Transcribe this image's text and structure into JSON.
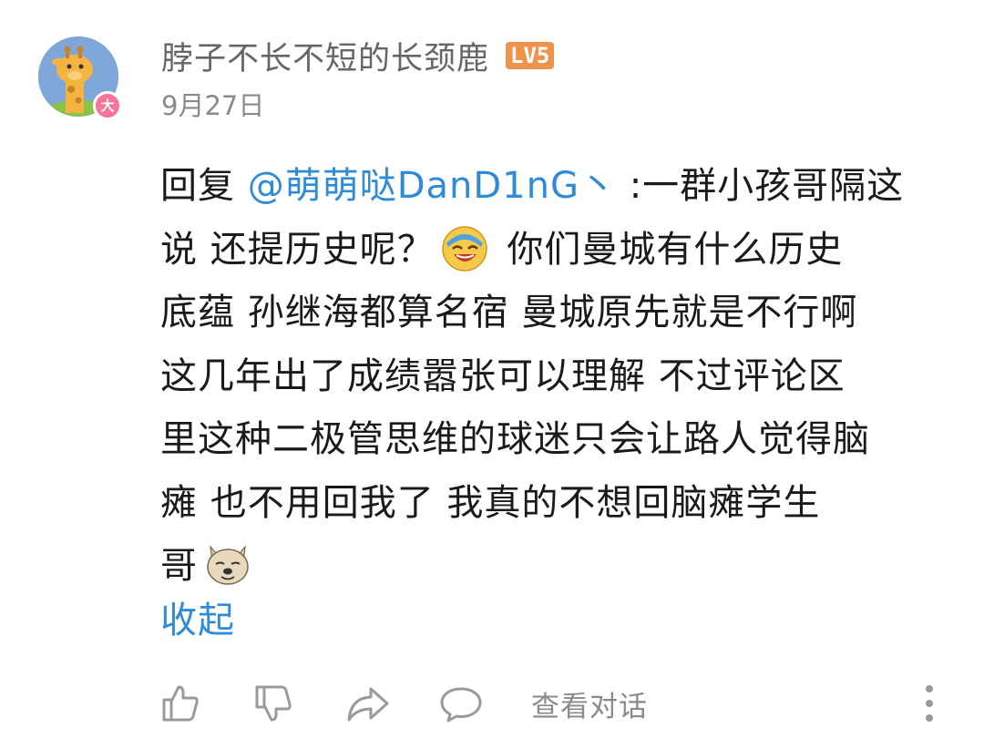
{
  "user": {
    "name": "脖子不长不短的长颈鹿",
    "level": "LV5",
    "badge": "大",
    "date": "9月27日"
  },
  "comment": {
    "reply_prefix": "回复 ",
    "mention": "@萌萌哒DanD1nG丶",
    "line1_rest": " :一群小孩哥隔这",
    "line2_a": "说  还提历史呢？",
    "line2_b": "  你们曼城有什么历史",
    "line3": "底蕴   孙继海都算名宿  曼城原先就是不行啊",
    "line4": "这几年出了成绩嚣张可以理解  不过评论区",
    "line5": "里这种二极管思维的球迷只会让路人觉得脑",
    "line6": "瘫   也不用回我了   我真的不想回脑瘫学生",
    "line7": "哥",
    "collapse": "收起"
  },
  "actions": {
    "view_thread": "查看对话"
  },
  "icons": {
    "like": "thumbs-up-icon",
    "dislike": "thumbs-down-icon",
    "share": "share-icon",
    "reply": "reply-bubble-icon",
    "more": "more-vertical-icon"
  },
  "colors": {
    "link": "#2f8bd6",
    "level_badge": "#f0934a",
    "vip_badge": "#fb7299",
    "muted": "#8a8a8a"
  }
}
